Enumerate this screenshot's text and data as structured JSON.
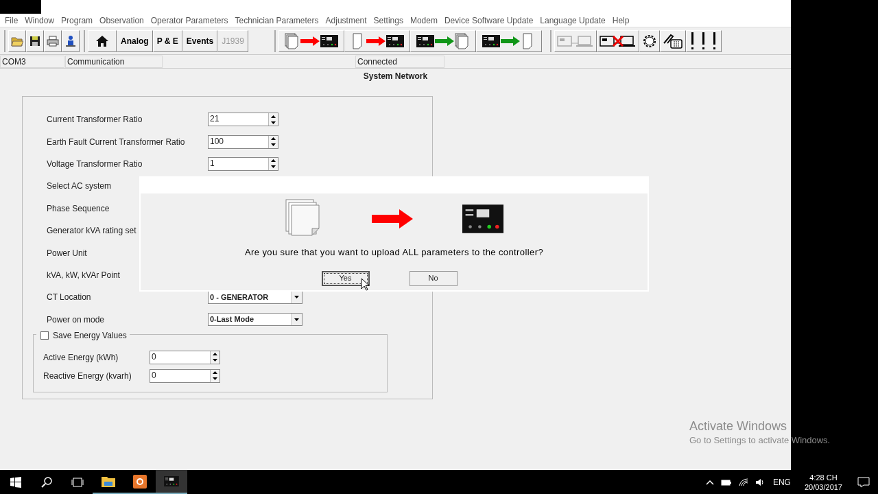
{
  "menu": [
    "File",
    "Window",
    "Program",
    "Observation",
    "Operator Parameters",
    "Technician Parameters",
    "Adjustment",
    "Settings",
    "Modem",
    "Device Software Update",
    "Language Update",
    "Help"
  ],
  "toolbar": {
    "file_buttons": [
      {
        "kind": "open"
      },
      {
        "kind": "save"
      },
      {
        "kind": "print"
      },
      {
        "kind": "person"
      }
    ],
    "view_buttons": [
      {
        "kind": "home"
      },
      {
        "kind": "text",
        "label": "Analog",
        "disabled": false
      },
      {
        "kind": "text",
        "label": "P & E",
        "disabled": false
      },
      {
        "kind": "text",
        "label": "Events",
        "disabled": false
      },
      {
        "kind": "text",
        "label": "J1939",
        "disabled": true
      }
    ],
    "transfer_buttons": [
      {
        "kind": "upload_all"
      },
      {
        "kind": "upload_one"
      },
      {
        "kind": "download_all"
      },
      {
        "kind": "download_one"
      }
    ],
    "connection_buttons": [
      {
        "kind": "connect",
        "disabled": true
      },
      {
        "kind": "disconnect",
        "disabled": false
      },
      {
        "kind": "gear",
        "disabled": false
      },
      {
        "kind": "phone",
        "disabled": false
      },
      {
        "kind": "alarm",
        "disabled": false
      }
    ]
  },
  "status_bar": [
    "COM3",
    "Communication",
    "Connected"
  ],
  "panel": {
    "title": "System Network",
    "rows": [
      {
        "label": "Current Transformer Ratio",
        "kind": "spin",
        "value": "21"
      },
      {
        "label": "Earth Fault Current Transformer Ratio",
        "kind": "spin",
        "value": "100"
      },
      {
        "label": "Voltage Transformer Ratio",
        "kind": "spin",
        "value": "1"
      },
      {
        "label": "Select AC system",
        "kind": "hidden"
      },
      {
        "label": "Phase Sequence",
        "kind": "hidden"
      },
      {
        "label": "Generator kVA rating set",
        "kind": "hidden"
      },
      {
        "label": "Power Unit",
        "kind": "hidden"
      },
      {
        "label": "kVA, kW, kVAr Point",
        "kind": "hidden"
      },
      {
        "label": "CT Location",
        "kind": "combo",
        "value": "0 - GENERATOR"
      },
      {
        "label": "Power on mode",
        "kind": "combo",
        "value": "0-Last Mode"
      }
    ],
    "energy": {
      "checkbox": {
        "label": "Save Energy Values",
        "checked": false
      },
      "rows": [
        {
          "label": "Active Energy (kWh)",
          "value": "0"
        },
        {
          "label": "Reactive Energy (kvarh)",
          "value": "0"
        }
      ]
    }
  },
  "dialog": {
    "message": "Are you sure that you want to upload ALL parameters to the controller?",
    "buttons": [
      {
        "label": "Yes",
        "selected": true
      },
      {
        "label": "No",
        "selected": false
      }
    ]
  },
  "watermark": {
    "title": "Activate Windows",
    "text": "Go to Settings to activate Windows."
  },
  "taskbar": {
    "apps": [
      {
        "kind": "explorer",
        "selected": false
      },
      {
        "kind": "orange",
        "selected": false
      },
      {
        "kind": "controller",
        "selected": true
      }
    ],
    "language": "ENG",
    "time": "4:28 CH",
    "date": "20/03/2017"
  }
}
